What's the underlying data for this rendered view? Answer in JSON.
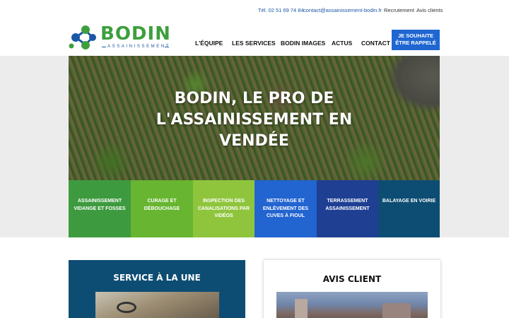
{
  "topbar": {
    "phone": "Tél. 02 51 69 74 84",
    "email": "contact@assainissement-bodin.fr",
    "recruitment": "Recrutement",
    "reviews": "Avis clients"
  },
  "brand": {
    "name": "BODIN",
    "subtitle": "ASSAINISSEMENT",
    "green": "#3d9f3d",
    "blue": "#1a57a6"
  },
  "nav": {
    "items": [
      "L'ÉQUIPE",
      "LES SERVICES",
      "BODIN IMAGES",
      "ACTUS",
      "CONTACT"
    ],
    "cta_line1": "JE SOUHAITE",
    "cta_line2": "ÊTRE RAPPELÉ"
  },
  "hero": {
    "line1": "BODIN, LE PRO DE",
    "line2": "L'ASSAINISSEMENT EN",
    "line3": "VENDÉE"
  },
  "services": [
    {
      "l1": "ASSAINISSEMENT",
      "l2": "VIDANGE ET FOSSES",
      "l3": "",
      "color": "#3e9a3f"
    },
    {
      "l1": "CURAGE ET",
      "l2": "DÉBOUCHAGE",
      "l3": "",
      "color": "#67b530"
    },
    {
      "l1": "INSPECTION DES",
      "l2": "CANALISATIONS PAR",
      "l3": "VIDÉOS",
      "color": "#8fc53d"
    },
    {
      "l1": "NETTOYAGE ET",
      "l2": "ENLÈVEMENT DES",
      "l3": "CUVES À FIOUL",
      "color": "#2264d0"
    },
    {
      "l1": "TERRASSEMENT",
      "l2": "ASSAINISSEMENT",
      "l3": "",
      "color": "#1f3f93"
    },
    {
      "l1": "BALAYAGE EN VOIRIE",
      "l2": "",
      "l3": "",
      "color": "#0e4d73"
    }
  ],
  "featured": {
    "title": "SERVICE À LA UNE"
  },
  "review": {
    "title": "AVIS CLIENT"
  }
}
